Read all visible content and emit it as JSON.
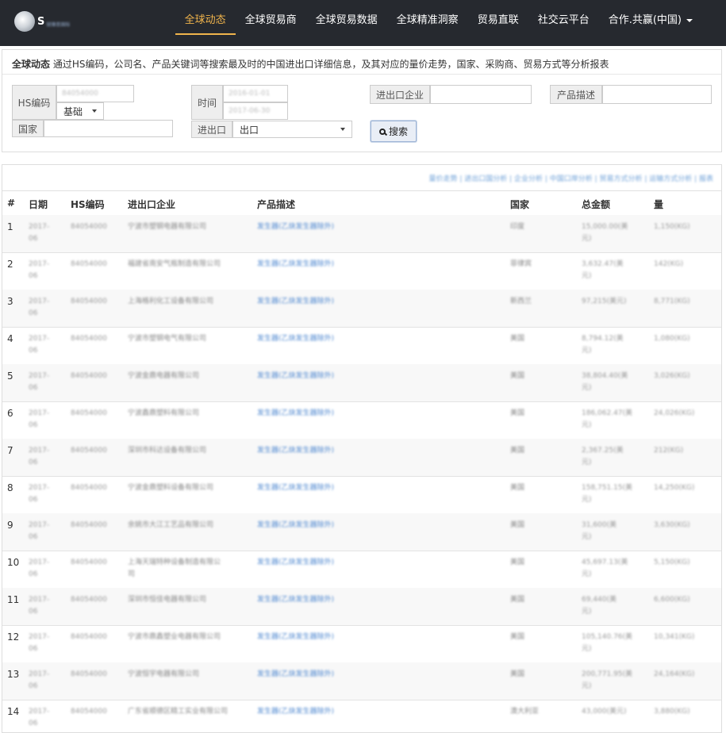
{
  "nav": {
    "logo_text": "S",
    "logo_sub": "锐锋思国际",
    "items": [
      {
        "label": "全球动态",
        "active": true
      },
      {
        "label": "全球贸易商",
        "active": false
      },
      {
        "label": "全球贸易数据",
        "active": false
      },
      {
        "label": "全球精准洞察",
        "active": false
      },
      {
        "label": "贸易直联",
        "active": false
      },
      {
        "label": "社交云平台",
        "active": false
      },
      {
        "label": "合作.共赢(中国)",
        "active": false,
        "dropdown": true
      }
    ]
  },
  "search": {
    "intro_title": "全球动态",
    "intro_text": "通过HS编码，公司名、产品关键词等搜索最及时的中国进出口详细信息，及其对应的量价走势，国家、采购商、贸易方式等分析报表",
    "hs_label": "HS编码",
    "hs_value": "84054000",
    "hs_mode": "基础",
    "time_label": "时间",
    "time_from": "2016-01-01",
    "time_to": "2017-06-30",
    "company_label": "进出口企业",
    "company_value": "",
    "product_label": "产品描述",
    "product_value": "",
    "country_label": "国家",
    "country_value": "",
    "direction_label": "进出口",
    "direction_value": "出口",
    "search_button": "搜索"
  },
  "results": {
    "links": "量价走势 | 进出口国分析 | 企业分析 | 中国口岸分析 | 贸易方式分析 | 运输方式分析 | 报表",
    "columns": [
      "#",
      "日期",
      "HS编码",
      "进出口企业",
      "产品描述",
      "国家",
      "总金额",
      "量"
    ],
    "rows": [
      {
        "n": "1",
        "date_a": "2017-",
        "date_b": "06",
        "hs": "84054000",
        "company": "宁波市塑钢电器有限公司",
        "product": "发生器(乙炔发生器除外)",
        "country": "印度",
        "amount_a": "15,000.00(美",
        "amount_b": "元)",
        "qty": "1,150(KG)"
      },
      {
        "n": "2",
        "date_a": "2017-",
        "date_b": "06",
        "hs": "84054000",
        "company": "福建省南安气瓶制造有限公司",
        "product": "发生器(乙炔发生器除外)",
        "country": "菲律宾",
        "amount_a": "3,632.47(美",
        "amount_b": "元)",
        "qty": "142(KG)"
      },
      {
        "n": "3",
        "date_a": "2017-",
        "date_b": "06",
        "hs": "84054000",
        "company": "上海格利化工设备有限公司",
        "product": "发生器(乙炔发生器除外)",
        "country": "新西兰",
        "amount_a": "97,215(美元)",
        "qty": "8,771(KG)"
      },
      {
        "n": "4",
        "date_a": "2017-",
        "date_b": "06",
        "hs": "84054000",
        "company": "宁波市塑钢电气有限公司",
        "product": "发生器(乙炔发生器除外)",
        "country": "美国",
        "amount_a": "8,794.12(美",
        "amount_b": "元)",
        "qty": "1,080(KG)"
      },
      {
        "n": "5",
        "date_a": "2017-",
        "date_b": "06",
        "hs": "84054000",
        "company": "宁波金鼎电器有限公司",
        "product": "发生器(乙炔发生器除外)",
        "country": "美国",
        "amount_a": "38,804.40(美",
        "amount_b": "元)",
        "qty": "3,026(KG)"
      },
      {
        "n": "6",
        "date_a": "2017-",
        "date_b": "06",
        "hs": "84054000",
        "company": "宁波鑫鼎塑料有限公司",
        "product": "发生器(乙炔发生器除外)",
        "country": "美国",
        "amount_a": "186,062.47(美",
        "amount_b": "元)",
        "qty": "24,026(KG)"
      },
      {
        "n": "7",
        "date_a": "2017-",
        "date_b": "06",
        "hs": "84054000",
        "company": "深圳市科达设备有限公司",
        "product": "发生器(乙炔发生器除外)",
        "country": "美国",
        "amount_a": "2,367.25(美",
        "amount_b": "元)",
        "qty": "212(KG)"
      },
      {
        "n": "8",
        "date_a": "2017-",
        "date_b": "06",
        "hs": "84054000",
        "company": "宁波金鼎塑料设备有限公司",
        "product": "发生器(乙炔发生器除外)",
        "country": "美国",
        "amount_a": "158,751.15(美",
        "amount_b": "元)",
        "qty": "14,250(KG)"
      },
      {
        "n": "9",
        "date_a": "2017-",
        "date_b": "06",
        "hs": "84054000",
        "company": "余姚市大江工艺品有限公司",
        "product": "发生器(乙炔发生器除外)",
        "country": "美国",
        "amount_a": "31,600(美",
        "amount_b": "元)",
        "qty": "3,630(KG)"
      },
      {
        "n": "10",
        "date_a": "2017-",
        "date_b": "06",
        "hs": "84054000",
        "company": "上海天瑞特种设备制造有限公",
        "company_b": "司",
        "product": "发生器(乙炔发生器除外)",
        "country": "美国",
        "amount_a": "45,697.13(美",
        "amount_b": "元)",
        "qty": "5,150(KG)"
      },
      {
        "n": "11",
        "date_a": "2017-",
        "date_b": "06",
        "hs": "84054000",
        "company": "深圳市恒佳电器有限公司",
        "product": "发生器(乙炔发生器除外)",
        "country": "美国",
        "amount_a": "69,440(美",
        "amount_b": "元)",
        "qty": "6,600(KG)"
      },
      {
        "n": "12",
        "date_a": "2017-",
        "date_b": "06",
        "hs": "84054000",
        "company": "宁波市鼎鑫塑业电器有限公司",
        "product": "发生器(乙炔发生器除外)",
        "country": "美国",
        "amount_a": "105,140.76(美",
        "amount_b": "元)",
        "qty": "10,341(KG)"
      },
      {
        "n": "13",
        "date_a": "2017-",
        "date_b": "06",
        "hs": "84054000",
        "company": "宁波恒宇电器有限公司",
        "product": "发生器(乙炔发生器除外)",
        "country": "美国",
        "amount_a": "200,771.95(美",
        "amount_b": "元)",
        "qty": "24,164(KG)"
      },
      {
        "n": "14",
        "date_a": "2017-",
        "date_b": "06",
        "hs": "84054000",
        "company": "广东省顺德区精工实业有限公司",
        "product": "发生器(乙炔发生器除外)",
        "country": "澳大利亚",
        "amount_a": "43,000(美元)",
        "qty": "3,880(KG)"
      }
    ]
  }
}
